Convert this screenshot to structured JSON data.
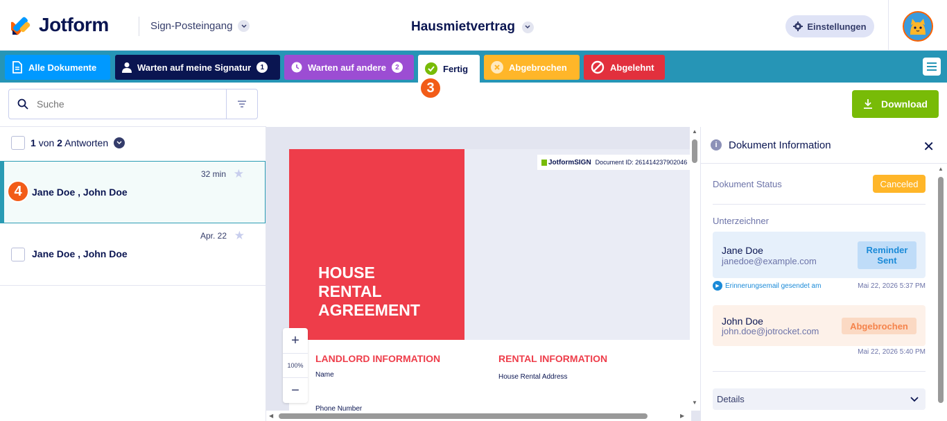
{
  "header": {
    "brand": "Jotform",
    "inbox_label": "Sign-Posteingang",
    "document_title": "Hausmietvertrag",
    "settings_label": "Einstellungen"
  },
  "tabs": {
    "all": "Alle Dokumente",
    "waiting_me": "Warten auf meine Signatur",
    "waiting_me_count": "1",
    "waiting_others": "Warten auf andere",
    "waiting_others_count": "2",
    "done": "Fertig",
    "canceled": "Abgebrochen",
    "declined": "Abgelehnt"
  },
  "step_badges": {
    "tab": "3",
    "item": "4"
  },
  "search": {
    "placeholder": "Suche"
  },
  "download_label": "Download",
  "list": {
    "count_current": "1",
    "count_of": "von",
    "count_total": "2",
    "count_label": "Antworten",
    "items": [
      {
        "time": "32 min",
        "names": "Jane Doe , John Doe"
      },
      {
        "time": "Apr. 22",
        "names": "Jane Doe , John Doe"
      }
    ]
  },
  "preview": {
    "title_line1": "HOUSE",
    "title_line2": "RENTAL",
    "title_line3": "AGREEMENT",
    "brand_small": "JotformSIGN",
    "document_id": "Document ID: 261414237902046",
    "landlord_title": "LANDLORD INFORMATION",
    "rental_title": "RENTAL INFORMATION",
    "name_label": "Name",
    "address_label": "House Rental Address",
    "phone_label": "Phone Number",
    "zoom_level": "100%"
  },
  "info_panel": {
    "title": "Dokument Information",
    "status_label": "Dokument Status",
    "status_value": "Canceled",
    "signers_label": "Unterzeichner",
    "signers": [
      {
        "name": "Jane Doe",
        "email": "janedoe@example.com",
        "badge": "Reminder Sent"
      },
      {
        "name": "John Doe",
        "email": "john.doe@jotrocket.com",
        "badge": "Abgebrochen"
      }
    ],
    "reminder_text": "Erinnerungsemail gesendet am",
    "reminder_time": "Mai 22, 2026 5:37 PM",
    "cancel_time": "Mai 22, 2026 5:40 PM",
    "details_label": "Details"
  },
  "colors": {
    "tabbar": "#2695b6",
    "all_tab": "#0099ff",
    "waiting_me_tab": "#0a1551",
    "waiting_others_tab": "#9c4dd3",
    "canceled_tab": "#ffb629",
    "declined_tab": "#e2303d",
    "download": "#78bb07",
    "step_badge": "#f25c18"
  }
}
